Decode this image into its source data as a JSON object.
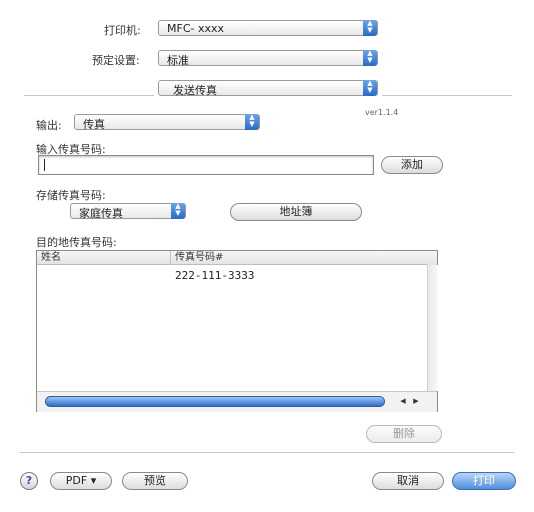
{
  "printer": {
    "label": "打印机:",
    "value": "MFC- xxxx"
  },
  "preset": {
    "label": "预定设置:",
    "value": "标准"
  },
  "panel": {
    "value": "发送传真"
  },
  "version": "ver1.1.4",
  "output": {
    "label": "输出:",
    "value": "传真"
  },
  "input_fax": {
    "label": "输入传真号码:",
    "value": "",
    "add_button": "添加"
  },
  "stored_fax": {
    "label": "存储传真号码:",
    "value": "家庭传真",
    "address_book_button": "地址簿"
  },
  "destination": {
    "label": "目的地传真号码:",
    "columns": [
      "姓名",
      "传真号码#"
    ],
    "rows": [
      {
        "name": "",
        "fax": "222-111-3333"
      }
    ],
    "delete_button": "删除"
  },
  "footer": {
    "help": "?",
    "pdf_button": "PDF ▾",
    "preview_button": "预览",
    "cancel_button": "取消",
    "print_button": "打印"
  }
}
